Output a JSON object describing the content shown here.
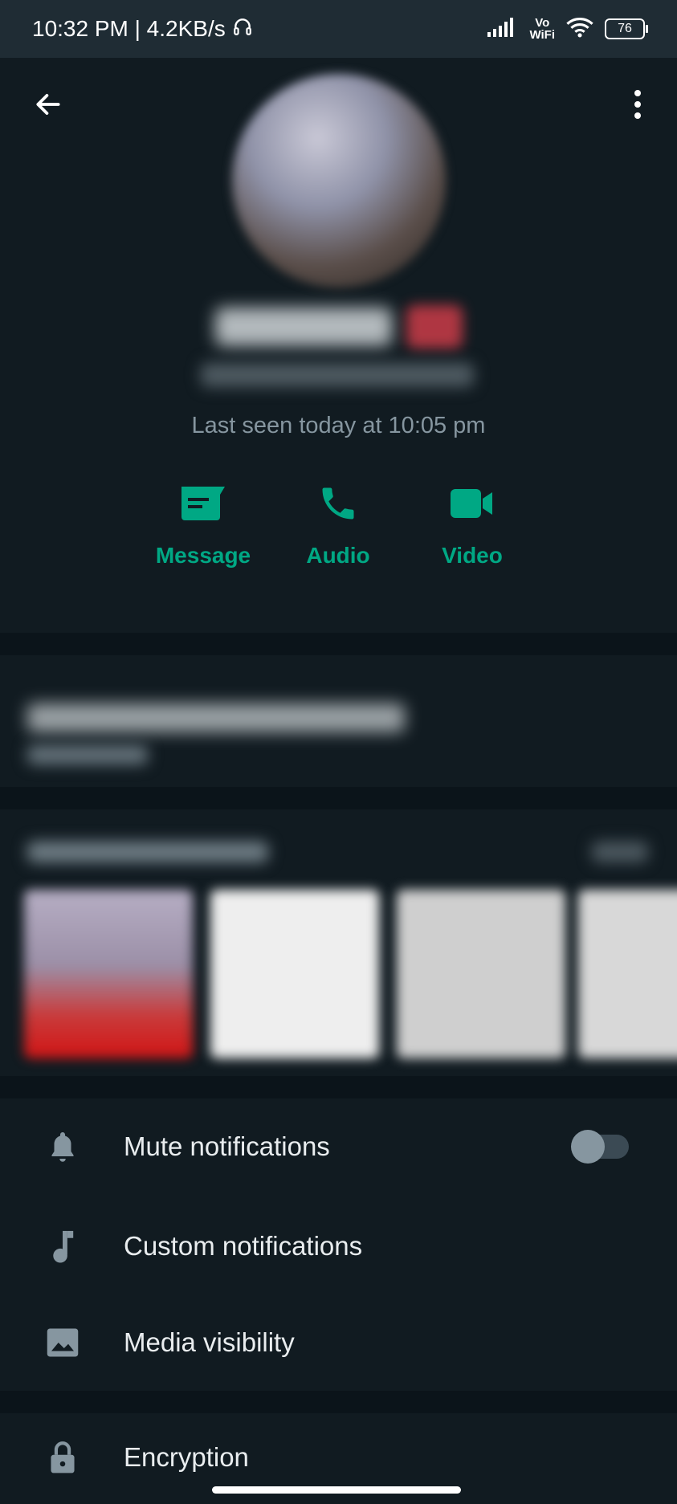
{
  "status_bar": {
    "time_speed": "10:32 PM | 4.2KB/s",
    "vowifi_top": "Vo",
    "vowifi_bottom": "WiFi",
    "battery": "76"
  },
  "profile": {
    "last_seen": "Last seen today at 10:05 pm"
  },
  "actions": {
    "message": "Message",
    "audio": "Audio",
    "video": "Video"
  },
  "settings": {
    "mute": "Mute notifications",
    "custom": "Custom notifications",
    "media_visibility": "Media visibility",
    "encryption": "Encryption",
    "mute_enabled": false
  },
  "icons": {
    "back": "arrow-back-icon",
    "more": "more-vertical-icon",
    "message": "message-icon",
    "audio": "phone-icon",
    "video": "video-camera-icon",
    "mute": "bell-icon",
    "custom": "music-note-icon",
    "media": "image-icon",
    "encryption": "lock-icon"
  },
  "colors": {
    "accent": "#00a884",
    "background": "#0b141a",
    "panel": "#111b21",
    "muted_text": "#8696a0"
  }
}
